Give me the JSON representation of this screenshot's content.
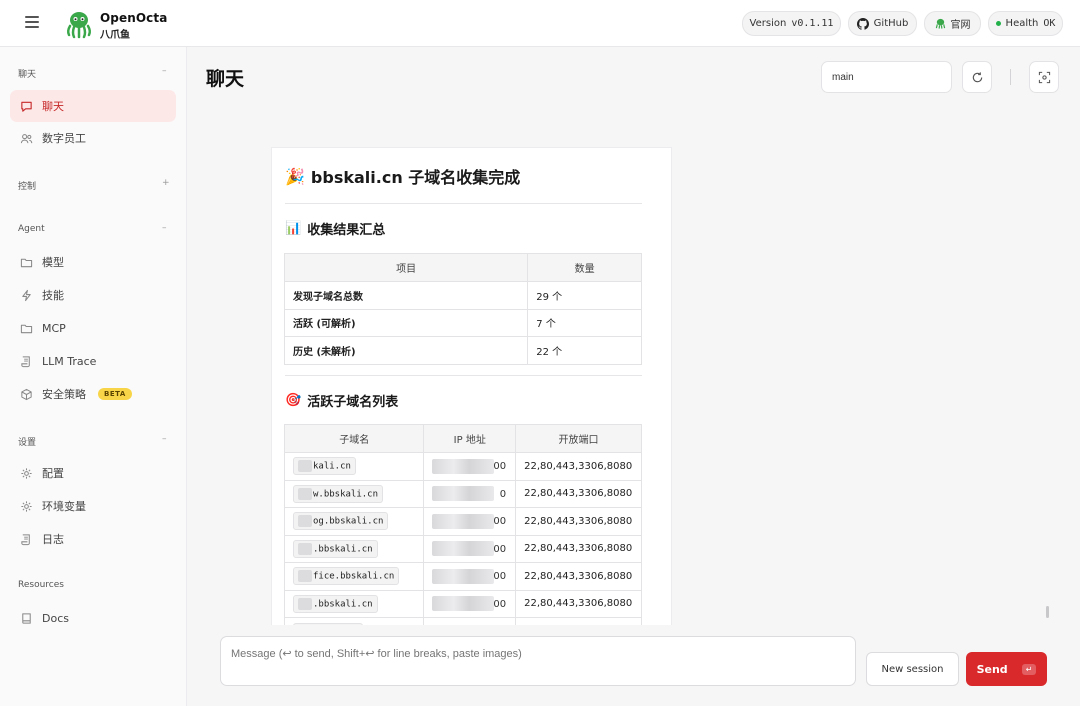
{
  "brand": {
    "name": "OpenOcta",
    "subtitle": "八爪鱼"
  },
  "header": {
    "version_label": "Version",
    "version_value": "v0.1.11",
    "github_label": "GitHub",
    "website_label": "官网",
    "health_label": "Health",
    "health_value": "OK",
    "health_color": "#22b04b"
  },
  "sidebar": {
    "sections": [
      {
        "title": "聊天",
        "items": [
          {
            "label": "聊天",
            "icon": "chat-icon",
            "active": true
          },
          {
            "label": "数字员工",
            "icon": "users-icon"
          }
        ]
      },
      {
        "title": "控制",
        "items": []
      },
      {
        "title": "Agent",
        "items": [
          {
            "label": "模型",
            "icon": "folder-icon"
          },
          {
            "label": "技能",
            "icon": "bolt-icon"
          },
          {
            "label": "MCP",
            "icon": "folder-icon"
          },
          {
            "label": "LLM Trace",
            "icon": "scroll-icon"
          },
          {
            "label": "安全策略",
            "icon": "cube-icon",
            "badge": "BETA"
          }
        ]
      },
      {
        "title": "设置",
        "items": [
          {
            "label": "配置",
            "icon": "gear-icon"
          },
          {
            "label": "环境变量",
            "icon": "gear-icon"
          },
          {
            "label": "日志",
            "icon": "scroll-icon"
          }
        ]
      },
      {
        "title": "Resources",
        "items": [
          {
            "label": "Docs",
            "icon": "book-icon"
          }
        ]
      }
    ]
  },
  "main": {
    "title": "聊天",
    "session_value": "main"
  },
  "message": {
    "heading": "bbskali.cn 子域名收集完成",
    "heading_emoji": "🎉",
    "summary_heading": "收集结果汇总",
    "summary_emoji": "📊",
    "summary_columns": [
      "项目",
      "数量"
    ],
    "summary_rows": [
      [
        "发现子域名总数",
        "29 个"
      ],
      [
        "活跃 (可解析)",
        "7 个"
      ],
      [
        "历史 (未解析)",
        "22 个"
      ]
    ],
    "active_heading": "活跃子域名列表",
    "active_emoji": "🎯",
    "active_columns": [
      "子域名",
      "IP 地址",
      "开放端口"
    ],
    "active_rows": [
      {
        "domain": "kali.cn",
        "ip_tail": "00",
        "ports": "22,80,443,3306,8080"
      },
      {
        "domain": "w.bbskali.cn",
        "ip_tail": "0",
        "ports": "22,80,443,3306,8080"
      },
      {
        "domain": "og.bbskali.cn",
        "ip_tail": "00",
        "ports": "22,80,443,3306,8080"
      },
      {
        "domain": ".bbskali.cn",
        "ip_tail": "00",
        "ports": "22,80,443,3306,8080"
      },
      {
        "domain": "fice.bbskali.cn",
        "ip_tail": "00",
        "ports": "22,80,443,3306,8080"
      },
      {
        "domain": ".bbskali.cn",
        "ip_tail": "00",
        "ports": "22,80,443,3306,8080"
      }
    ]
  },
  "composer": {
    "placeholder": "Message (↩ to send, Shift+↩ for line breaks, paste images)",
    "new_session_label": "New session",
    "send_label": "Send",
    "send_hint": "↵"
  }
}
